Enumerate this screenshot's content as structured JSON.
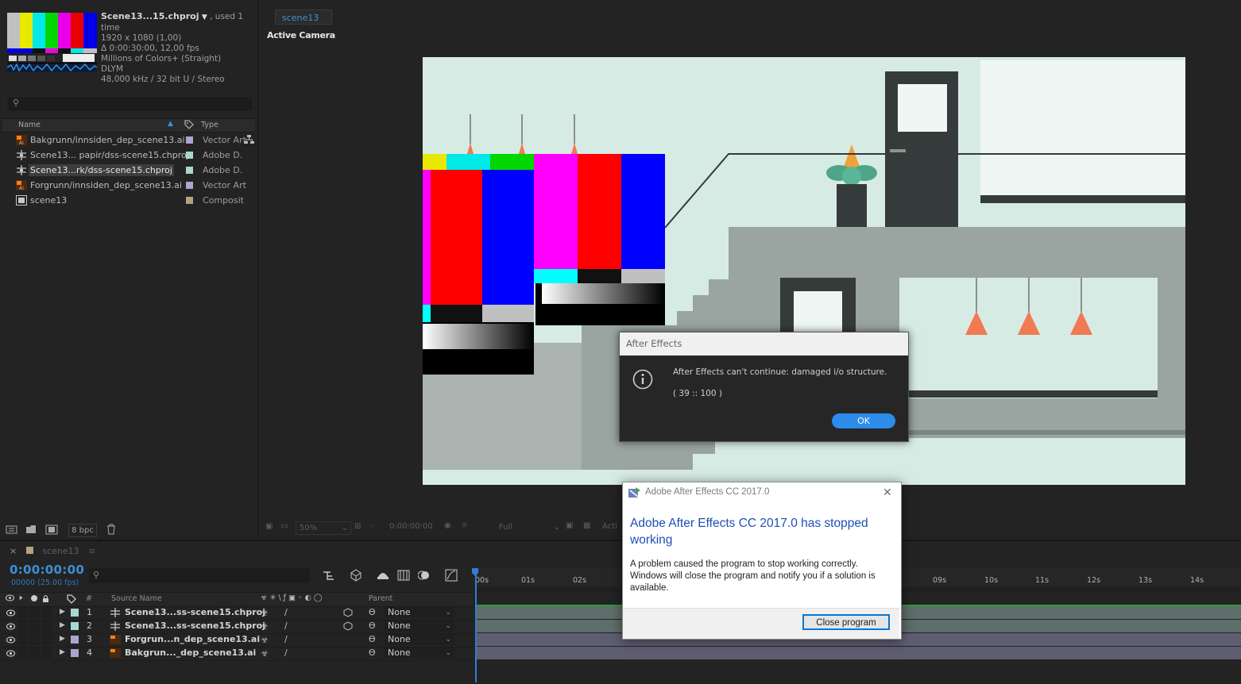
{
  "project": {
    "title": "Scene13...15.chproj",
    "used": ", used 1 time",
    "info": [
      "1920 x 1080 (1,00)",
      "Δ 0:00:30:00, 12,00 fps",
      "Millions of Colors+ (Straight)",
      "DLYM",
      "48,000 kHz / 32 bit U / Stereo"
    ],
    "col_name": "Name",
    "col_type": "Type",
    "items": [
      {
        "name": "Bakgrunn/innsiden_dep_scene13.ai",
        "type": "Vector Art"
      },
      {
        "name": "Scene13... papir/dss-scene15.chproj",
        "type": "Adobe D."
      },
      {
        "name": "Scene13...rk/dss-scene15.chproj",
        "type": "Adobe D."
      },
      {
        "name": "Forgrunn/innsiden_dep_scene13.ai",
        "type": "Vector Art"
      },
      {
        "name": "scene13",
        "type": "Composit"
      }
    ],
    "bpc": "8 bpc"
  },
  "viewer": {
    "tab": "scene13",
    "camera": "Active Camera",
    "zoom": "50%",
    "time": "0:00:00:00",
    "resolution": "Full",
    "view": "Acti"
  },
  "timeline": {
    "tab": "scene13",
    "timecode": "0:00:00:00",
    "fps": "00000 (25.00 fps)",
    "col_hash": "#",
    "col_source": "Source Name",
    "col_parent": "Parent",
    "ticks": [
      "00s",
      "01s",
      "02s",
      "09s",
      "10s",
      "11s",
      "12s",
      "13s",
      "14s"
    ],
    "layers": [
      {
        "num": "1",
        "name": "Scene13...ss-scene15.chproj",
        "parent": "None"
      },
      {
        "num": "2",
        "name": "Scene13...ss-scene15.chproj",
        "parent": "None"
      },
      {
        "num": "3",
        "name": "Forgrun...n_dep_scene13.ai",
        "parent": "None"
      },
      {
        "num": "4",
        "name": "Bakgrun..._dep_scene13.ai",
        "parent": "None"
      }
    ]
  },
  "ae_dialog": {
    "title": "After Effects",
    "message": "After Effects can't continue: damaged i/o structure.",
    "code": "( 39 :: 100 )",
    "ok": "OK"
  },
  "win_dialog": {
    "title": "Adobe After Effects CC 2017.0",
    "heading": "Adobe After Effects CC 2017.0 has stopped working",
    "body": "A problem caused the program to stop working correctly. Windows will close the program and notify you if a solution is available.",
    "button": "Close program"
  },
  "colors": {
    "accent": "#2d8ceb",
    "timecode": "#3d8fd6",
    "canvas_bg": "#d7ebe5",
    "win_heading": "#1d4fb5"
  }
}
